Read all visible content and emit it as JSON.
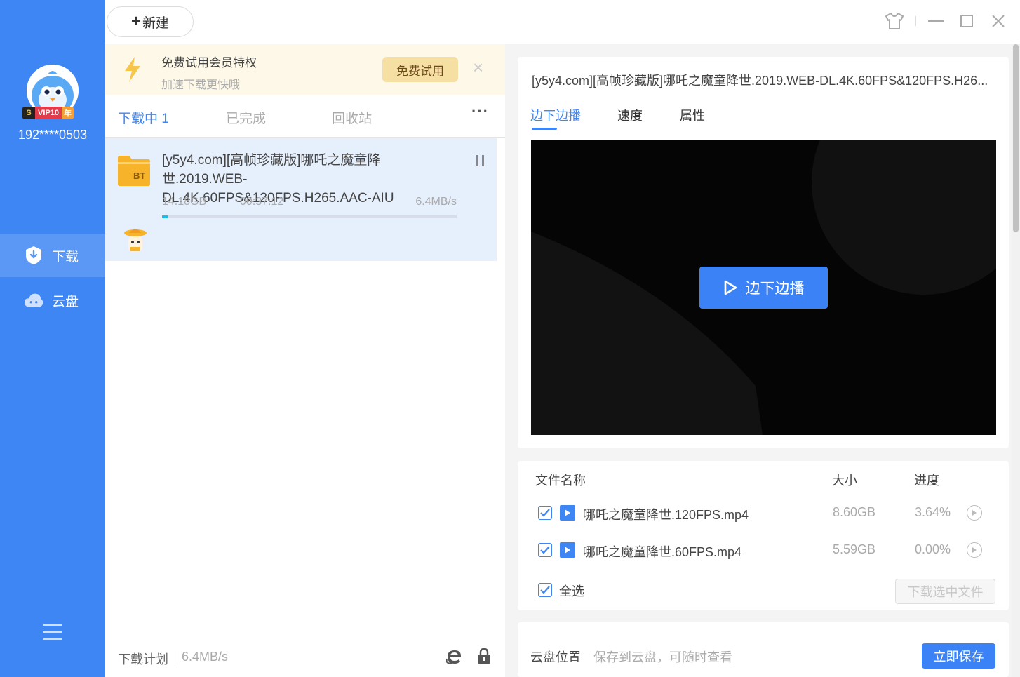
{
  "sidebar": {
    "vip_badge": {
      "s": "S",
      "text": "VIP10",
      "year": "年"
    },
    "username": "192****0503",
    "nav": [
      {
        "label": "下载",
        "icon": "download-shield-icon",
        "active": true
      },
      {
        "label": "云盘",
        "icon": "cloud-icon",
        "active": false
      }
    ]
  },
  "topbar": {
    "new_button": {
      "plus": "+",
      "label": "新建"
    }
  },
  "promo": {
    "title": "免费试用会员特权",
    "subtitle": "加速下载更快哦",
    "button": "免费试用",
    "close": "×"
  },
  "tabs": {
    "items": [
      {
        "label": "下载中 1",
        "active": true
      },
      {
        "label": "已完成",
        "active": false
      },
      {
        "label": "回收站",
        "active": false
      }
    ],
    "more": "···"
  },
  "task": {
    "icon_text": "BT",
    "name": "[y5y4.com][高帧珍藏版]哪吒之魔童降世.2019.WEB-DL.4K.60FPS&120FPS.H265.AAC-AIU",
    "size": "14.18GB",
    "time": "00:37:12",
    "speed": "6.4MB/s",
    "progress": 0.02
  },
  "footer": {
    "plan_label": "下载计划",
    "speed": "6.4MB/s"
  },
  "detail": {
    "title": "[y5y4.com][高帧珍藏版]哪吒之魔童降世.2019.WEB-DL.4K.60FPS&120FPS.H26...",
    "tabs": [
      {
        "label": "边下边播",
        "active": true
      },
      {
        "label": "速度",
        "active": false
      },
      {
        "label": "属性",
        "active": false
      }
    ],
    "play_button": "边下边播"
  },
  "files": {
    "headers": {
      "name": "文件名称",
      "size": "大小",
      "progress": "进度"
    },
    "rows": [
      {
        "name": "哪吒之魔童降世.120FPS.mp4",
        "size": "8.60GB",
        "progress": "3.64%",
        "checked": true
      },
      {
        "name": "哪吒之魔童降世.60FPS.mp4",
        "size": "5.59GB",
        "progress": "0.00%",
        "checked": true
      }
    ],
    "select_all": "全选",
    "download_selected": "下载选中文件"
  },
  "cloud": {
    "label": "云盘位置",
    "desc": "保存到云盘，可随时查看",
    "save_button": "立即保存"
  },
  "colors": {
    "sidebar": "#3f86f5",
    "accent": "#3a82f6",
    "progress": "#17c0e8",
    "promo_bg": "#fdf8e8",
    "task_bg": "#e6effc"
  }
}
